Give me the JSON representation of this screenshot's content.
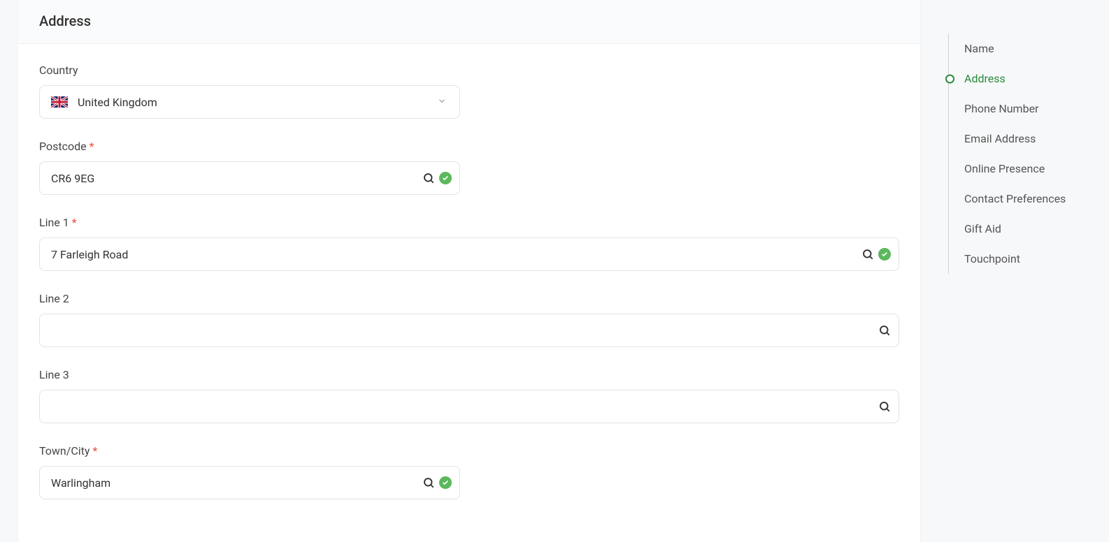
{
  "section": {
    "title": "Address"
  },
  "form": {
    "country": {
      "label": "Country",
      "value": "United Kingdom"
    },
    "postcode": {
      "label": "Postcode",
      "required": "*",
      "value": "CR6 9EG"
    },
    "line1": {
      "label": "Line 1",
      "required": "*",
      "value": "7 Farleigh Road"
    },
    "line2": {
      "label": "Line 2",
      "value": ""
    },
    "line3": {
      "label": "Line 3",
      "value": ""
    },
    "towncity": {
      "label": "Town/City",
      "required": "*",
      "value": "Warlingham"
    }
  },
  "nav": {
    "items": [
      {
        "label": "Name",
        "active": false
      },
      {
        "label": "Address",
        "active": true
      },
      {
        "label": "Phone Number",
        "active": false
      },
      {
        "label": "Email Address",
        "active": false
      },
      {
        "label": "Online Presence",
        "active": false
      },
      {
        "label": "Contact Preferences",
        "active": false
      },
      {
        "label": "Gift Aid",
        "active": false
      },
      {
        "label": "Touchpoint",
        "active": false
      }
    ]
  }
}
